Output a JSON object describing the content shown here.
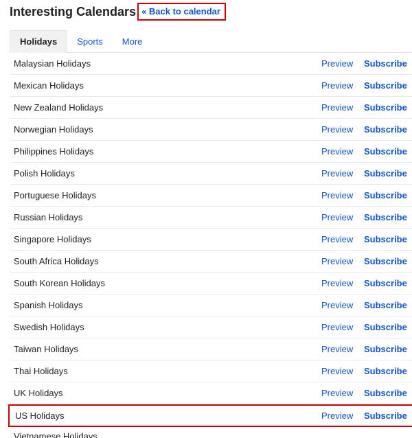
{
  "header": {
    "title": "Interesting Calendars",
    "back_link": "« Back to calendar"
  },
  "tabs": [
    {
      "label": "Holidays",
      "active": true
    },
    {
      "label": "Sports",
      "active": false
    },
    {
      "label": "More",
      "active": false
    }
  ],
  "actions": {
    "preview": "Preview",
    "subscribe": "Subscribe"
  },
  "calendars": [
    {
      "name": "Malaysian Holidays",
      "highlight": false
    },
    {
      "name": "Mexican Holidays",
      "highlight": false
    },
    {
      "name": "New Zealand Holidays",
      "highlight": false
    },
    {
      "name": "Norwegian Holidays",
      "highlight": false
    },
    {
      "name": "Philippines Holidays",
      "highlight": false
    },
    {
      "name": "Polish Holidays",
      "highlight": false
    },
    {
      "name": "Portuguese Holidays",
      "highlight": false
    },
    {
      "name": "Russian Holidays",
      "highlight": false
    },
    {
      "name": "Singapore Holidays",
      "highlight": false
    },
    {
      "name": "South Africa Holidays",
      "highlight": false
    },
    {
      "name": "South Korean Holidays",
      "highlight": false
    },
    {
      "name": "Spanish Holidays",
      "highlight": false
    },
    {
      "name": "Swedish Holidays",
      "highlight": false
    },
    {
      "name": "Taiwan Holidays",
      "highlight": false
    },
    {
      "name": "Thai Holidays",
      "highlight": false
    },
    {
      "name": "UK Holidays",
      "highlight": false
    },
    {
      "name": "US Holidays",
      "highlight": true
    },
    {
      "name": "Vietnamese Holidays",
      "highlight": false,
      "cut": true
    }
  ]
}
